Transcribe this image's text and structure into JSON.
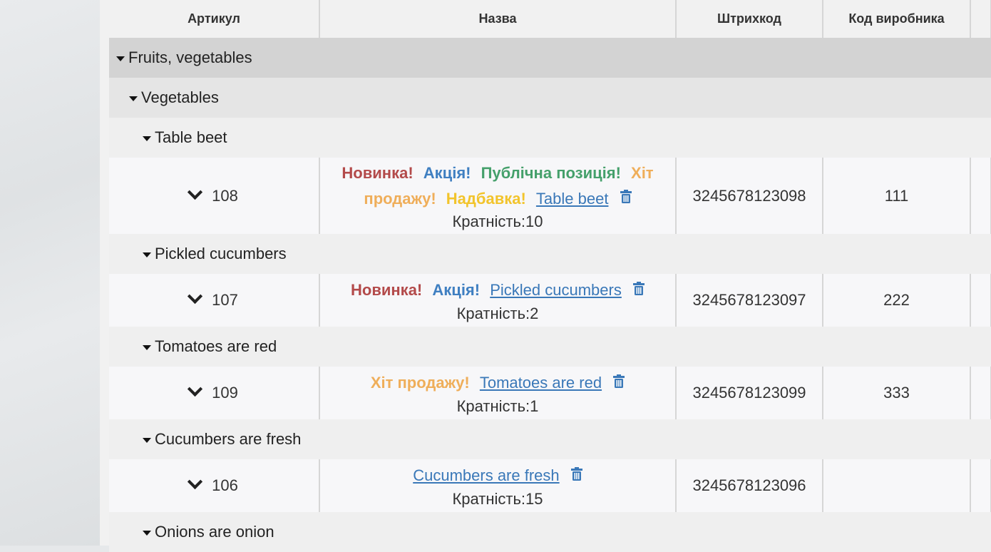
{
  "columns": {
    "article": "Артикул",
    "name": "Назва",
    "barcode": "Штрихкод",
    "manufacturer_code": "Код виробника"
  },
  "groups": {
    "category": "Fruits, vegetables",
    "subcategory": "Vegetables"
  },
  "badges": {
    "new": "Новинка!",
    "promo": "Акція!",
    "public": "Публічна позиція!",
    "hit": "Хіт продажу!",
    "markup": "Надбавка!"
  },
  "items": [
    {
      "group": "Table beet",
      "article": "108",
      "hit_line1": "Хіт",
      "hit_line2": "продажу!",
      "name": "Table beet",
      "multiplicity": "Кратність:10",
      "barcode": "3245678123098",
      "manufacturer_code": "111"
    },
    {
      "group": "Pickled cucumbers",
      "article": "107",
      "name": "Pickled cucumbers",
      "multiplicity": "Кратність:2",
      "barcode": "3245678123097",
      "manufacturer_code": "222"
    },
    {
      "group": "Tomatoes are red",
      "article": "109",
      "name": "Tomatoes are red",
      "multiplicity": "Кратність:1",
      "barcode": "3245678123099",
      "manufacturer_code": "333"
    },
    {
      "group": "Cucumbers are fresh",
      "article": "106",
      "name": "Cucumbers are fresh",
      "multiplicity": "Кратність:15",
      "barcode": "3245678123096",
      "manufacturer_code": ""
    },
    {
      "group": "Onions are onion"
    }
  ],
  "icons": {
    "expand": "caret-down-icon",
    "row_toggle": "chevron-down-icon",
    "delete": "trash-icon"
  },
  "colors": {
    "new": "#b34a4a",
    "promo": "#3f7fc1",
    "public": "#45a06b",
    "hit": "#efae5a",
    "markup": "#f2c42c",
    "link": "#3a78b8"
  }
}
